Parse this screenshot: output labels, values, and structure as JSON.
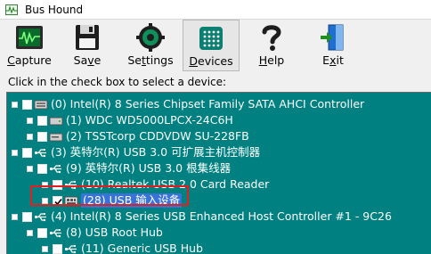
{
  "window": {
    "title": "Bus Hound"
  },
  "toolbar": {
    "buttons": [
      {
        "id": "capture",
        "label": "Capture",
        "underline": "C",
        "rest": "apture",
        "icon": "oscilloscope-icon"
      },
      {
        "id": "save",
        "label": "Save",
        "prefix": "Sa",
        "underline": "v",
        "rest": "e",
        "icon": "floppy-disk-icon"
      },
      {
        "id": "settings",
        "label": "Settings",
        "prefix": "Se",
        "underline": "t",
        "rest": "tings",
        "icon": "gear-icon"
      },
      {
        "id": "devices",
        "label": "Devices",
        "underline": "D",
        "rest": "evices",
        "icon": "device-chip-icon",
        "active": true
      },
      {
        "id": "help",
        "label": "Help",
        "underline": "H",
        "rest": "elp",
        "icon": "question-mark-icon"
      },
      {
        "id": "exit",
        "label": "Exit",
        "prefix": "E",
        "underline": "x",
        "rest": "it",
        "icon": "exit-door-icon"
      }
    ]
  },
  "instruction": "Click in the check box to select a device:",
  "tree": {
    "rows": [
      {
        "text": "(0) Intel(R) 8 Series Chipset Family SATA AHCI Controller",
        "icon": "sata-controller-icon",
        "checked": false
      },
      {
        "text": "(1) WDC WD5000LPCX-24C6H",
        "icon": "hard-disk-icon",
        "checked": false
      },
      {
        "text": "(2) TSSTcorp CDDVDW SU-228FB",
        "icon": "optical-drive-icon",
        "checked": false
      },
      {
        "text": "(3) 英特尔(R) USB 3.0 可扩展主机控制器",
        "icon": "usb-icon",
        "checked": false
      },
      {
        "text": "(9) 英特尔(R) USB 3.0 根集线器",
        "icon": "usb-icon",
        "checked": false
      },
      {
        "text": "(10) Realtek USB 2.0 Card Reader",
        "icon": "usb-icon",
        "checked": false
      },
      {
        "text": "(28) USB 输入设备",
        "icon": "input-device-icon",
        "checked": true,
        "selected": true
      },
      {
        "text": "(4) Intel(R) 8 Series USB Enhanced Host Controller #1 - 9C26",
        "icon": "usb-icon",
        "checked": false
      },
      {
        "text": "(8) USB Root Hub",
        "icon": "usb-icon",
        "checked": false
      },
      {
        "text": "(11) Generic USB Hub",
        "icon": "usb-icon",
        "checked": false
      }
    ]
  },
  "colors": {
    "tree_bg": "#008080",
    "selection": "#3874d8",
    "highlight": "#e02020"
  }
}
